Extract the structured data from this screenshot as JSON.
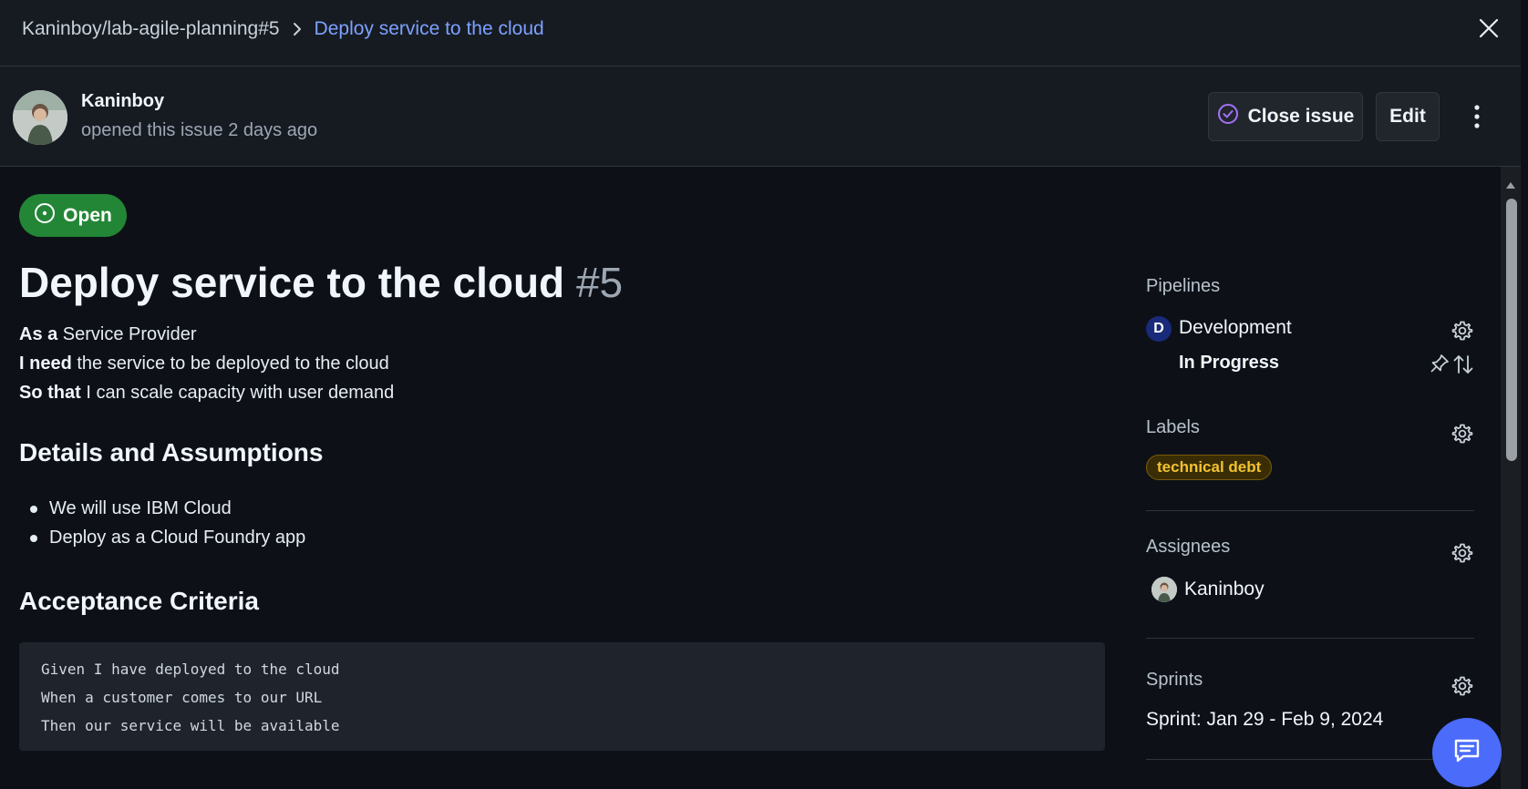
{
  "breadcrumb": {
    "repo": "Kaninboy/lab-agile-planning#5",
    "current": "Deploy service to the cloud"
  },
  "author": {
    "name": "Kaninboy",
    "meta": "opened this issue 2 days ago"
  },
  "actions": {
    "close_label": "Close issue",
    "edit_label": "Edit"
  },
  "issue": {
    "status": "Open",
    "title": "Deploy service to the cloud",
    "number": "#5",
    "story": [
      {
        "lead": "As a",
        "text": " Service Provider"
      },
      {
        "lead": "I need",
        "text": " the service to be deployed to the cloud"
      },
      {
        "lead": "So that",
        "text": " I can scale capacity with user demand"
      }
    ],
    "details_heading": "Details and Assumptions",
    "details": [
      "We will use IBM Cloud",
      "Deploy as a Cloud Foundry app"
    ],
    "acceptance_heading": "Acceptance Criteria",
    "acceptance_code": [
      "Given I have deployed to the cloud",
      "When a customer comes to our URL",
      "Then our service will be available"
    ]
  },
  "sidebar": {
    "pipelines_heading": "Pipelines",
    "pipeline_badge": "D",
    "pipeline_name": "Development",
    "pipeline_stage": "In Progress",
    "labels_heading": "Labels",
    "label": "technical debt",
    "assignees_heading": "Assignees",
    "assignee": "Kaninboy",
    "sprints_heading": "Sprints",
    "sprint": "Sprint: Jan 29 - Feb 9, 2024"
  },
  "colors": {
    "open_green": "#238636",
    "link_blue": "#7ea1ff",
    "label_yellow": "#f2c230",
    "fab_blue": "#4b6bfb"
  },
  "icons": [
    "chevron-right-icon",
    "close-icon",
    "check-circle-icon",
    "kebab-icon",
    "issue-open-icon",
    "gear-icon",
    "pin-icon",
    "arrows-up-down-icon",
    "chat-icon"
  ]
}
